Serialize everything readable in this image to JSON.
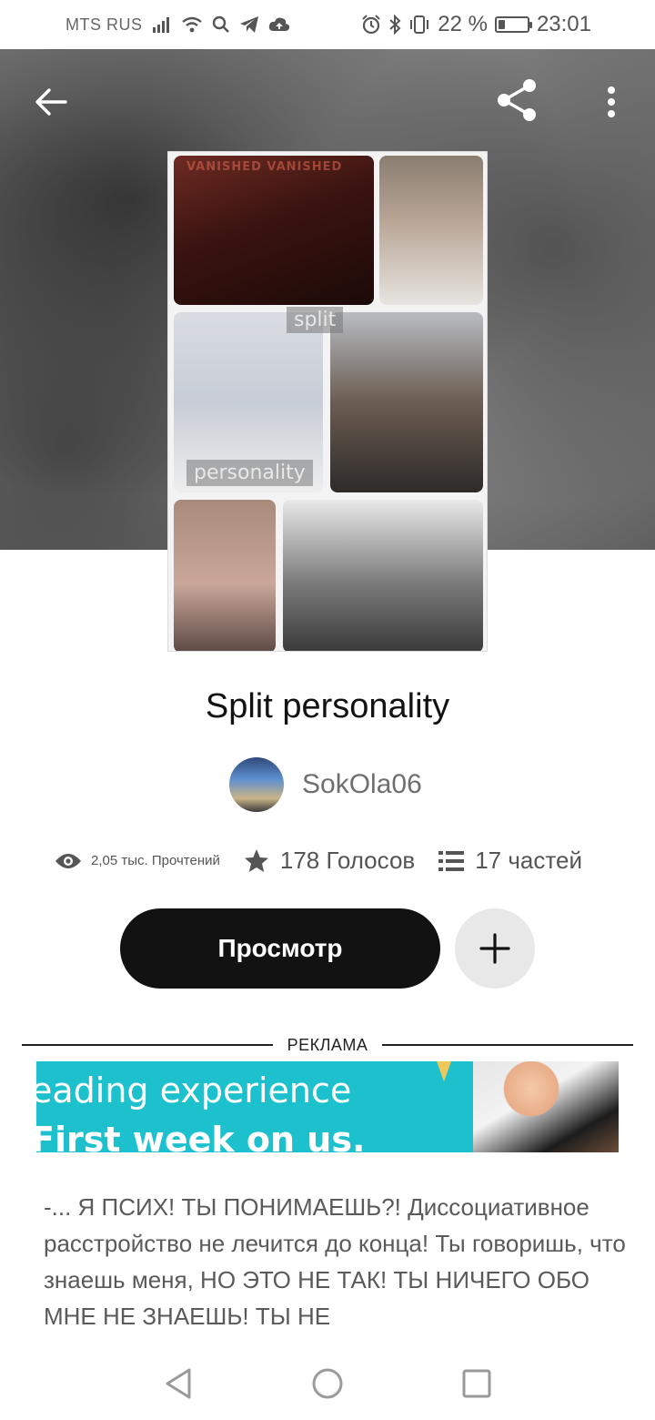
{
  "status_bar": {
    "carrier": "MTS RUS",
    "battery_text": "22 %",
    "battery_level": 0.22,
    "time": "23:01",
    "icons": [
      "signal-icon",
      "wifi-icon",
      "search-icon",
      "telegram-icon",
      "cloud-upload-icon",
      "alarm-icon",
      "bluetooth-icon",
      "vibrate-icon",
      "battery-icon"
    ]
  },
  "toolbar": {
    "back_icon": "arrow-left-icon",
    "share_icon": "share-icon",
    "more_icon": "more-vertical-icon"
  },
  "cover": {
    "label_split": "split",
    "label_personality": "personality",
    "label_vanished": "VANISHED VANISHED"
  },
  "story": {
    "title": "Split personality",
    "author": "SokOla06",
    "reads": "2,05 тыс. Прочтений",
    "votes": "178 Голосов",
    "parts": "17 частей"
  },
  "actions": {
    "read_label": "Просмотр",
    "add_icon": "plus-icon"
  },
  "ad": {
    "label": "РЕКЛАМА",
    "line1": "eading experience",
    "line2": "First week on us."
  },
  "excerpt": {
    "text": "-... Я ПСИХ! ТЫ ПОНИМАЕШЬ?! Диссоциативное расстройство не лечится до конца! Ты говоришь, что знаешь меня, НО ЭТО НЕ ТАК! ТЫ НИЧЕГО ОБО МНЕ НЕ ЗНАЕШЬ! ТЫ НЕ"
  },
  "nav": {
    "back_icon": "nav-back-icon",
    "home_icon": "nav-home-icon",
    "recents_icon": "nav-recents-icon"
  },
  "colors": {
    "primary_button": "#121212",
    "ad_background": "#1cc1cd",
    "add_button": "#e8e8e8"
  }
}
